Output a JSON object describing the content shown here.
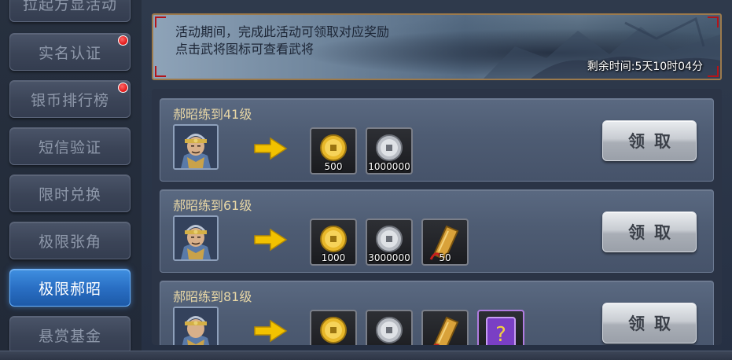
{
  "sidebar": {
    "items": [
      {
        "label": "拉起方显活动",
        "badge": false,
        "active": false
      },
      {
        "label": "实名认证",
        "badge": true,
        "active": false
      },
      {
        "label": "银币排行榜",
        "badge": true,
        "active": false
      },
      {
        "label": "短信验证",
        "badge": false,
        "active": false
      },
      {
        "label": "限时兑换",
        "badge": false,
        "active": false
      },
      {
        "label": "极限张角",
        "badge": false,
        "active": false
      },
      {
        "label": "极限郝昭",
        "badge": false,
        "active": true
      },
      {
        "label": "悬赏基金",
        "badge": false,
        "active": false
      }
    ]
  },
  "banner": {
    "line1": "活动期间，完成此活动可领取对应奖励",
    "line2": "点击武将图标可查看武将",
    "remaining_time": "剩余时间:5天10时04分"
  },
  "tasks": [
    {
      "title": "郝昭练到41级",
      "rewards": [
        {
          "icon": "gold-coin-icon",
          "qty": "500"
        },
        {
          "icon": "silver-coin-icon",
          "qty": "1000000"
        }
      ],
      "button": "领取"
    },
    {
      "title": "郝昭练到61级",
      "rewards": [
        {
          "icon": "gold-coin-icon",
          "qty": "1000"
        },
        {
          "icon": "silver-coin-icon",
          "qty": "3000000"
        },
        {
          "icon": "token-icon",
          "qty": "50"
        }
      ],
      "button": "领取"
    },
    {
      "title": "郝昭练到81级",
      "rewards": [
        {
          "icon": "gold-coin-icon",
          "qty": ""
        },
        {
          "icon": "silver-coin-icon",
          "qty": ""
        },
        {
          "icon": "token-icon",
          "qty": ""
        },
        {
          "icon": "mystery-pack-icon",
          "qty": ""
        }
      ],
      "button": "领取"
    }
  ],
  "colors": {
    "active_tab": "#2a6fc4",
    "title_text": "#e8d7a6",
    "badge": "#e01515"
  }
}
